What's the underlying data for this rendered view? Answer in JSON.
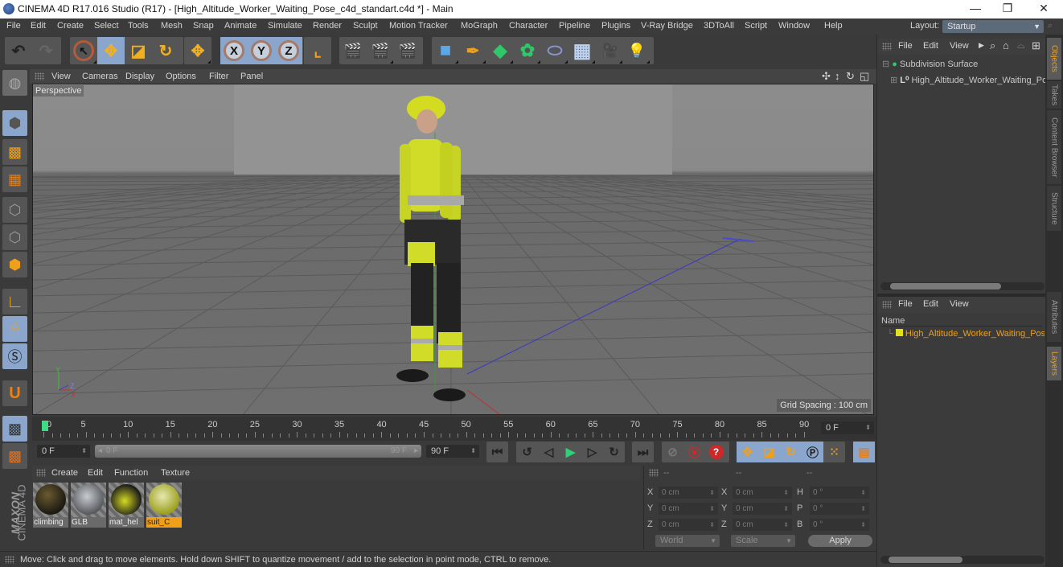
{
  "window": {
    "title": "CINEMA 4D R17.016 Studio (R17) - [High_Altitude_Worker_Waiting_Pose_c4d_standart.c4d *] - Main",
    "controls": {
      "minimize": "—",
      "restore": "❐",
      "close": "✕"
    }
  },
  "menubar": {
    "items": [
      "File",
      "Edit",
      "Create",
      "Select",
      "Tools",
      "Mesh",
      "Snap",
      "Animate",
      "Simulate",
      "Render",
      "Sculpt",
      "Motion Tracker",
      "MoGraph",
      "Character",
      "Pipeline",
      "Plugins",
      "V-Ray Bridge",
      "3DToAll",
      "Script",
      "Window",
      "Help"
    ],
    "layout_label": "Layout:",
    "layout_value": "Startup"
  },
  "toolbar": {
    "groups": [
      {
        "name": "history",
        "tools": [
          {
            "id": "undo",
            "icon": "undo-icon",
            "glyph": "↶"
          },
          {
            "id": "redo",
            "icon": "redo-icon",
            "glyph": "↷"
          }
        ]
      },
      {
        "name": "transform",
        "tools": [
          {
            "id": "live-select",
            "icon": "cursor-icon",
            "glyph": "↖"
          },
          {
            "id": "move",
            "icon": "move-icon",
            "glyph": "✥",
            "active": true
          },
          {
            "id": "scale",
            "icon": "scale-icon",
            "glyph": "◪"
          },
          {
            "id": "rotate",
            "icon": "rotate-icon",
            "glyph": "↻"
          }
        ]
      },
      {
        "name": "recent",
        "tools": [
          {
            "id": "recent-tool",
            "icon": "move-icon",
            "glyph": "✥"
          }
        ]
      },
      {
        "name": "axis",
        "tools": [
          {
            "id": "x-axis",
            "icon": "x-axis-icon",
            "glyph": "X",
            "active": true
          },
          {
            "id": "y-axis",
            "icon": "y-axis-icon",
            "glyph": "Y",
            "active": true
          },
          {
            "id": "z-axis",
            "icon": "z-axis-icon",
            "glyph": "Z",
            "active": true
          }
        ]
      },
      {
        "name": "coords",
        "tools": [
          {
            "id": "coordinate-system",
            "icon": "coordinate-system-icon",
            "glyph": "⌞"
          }
        ]
      },
      {
        "name": "render",
        "tools": [
          {
            "id": "render-view",
            "icon": "render-view-icon",
            "glyph": "🎬"
          },
          {
            "id": "render-picture-viewer",
            "icon": "render-picture-viewer-icon",
            "glyph": "🎬"
          },
          {
            "id": "render-settings",
            "icon": "render-settings-icon",
            "glyph": "🎬"
          }
        ]
      },
      {
        "name": "create",
        "tools": [
          {
            "id": "cube",
            "icon": "cube-icon",
            "glyph": "■"
          },
          {
            "id": "pen",
            "icon": "pen-icon",
            "glyph": "✒"
          },
          {
            "id": "subdivision",
            "icon": "subdivision-surface-icon",
            "glyph": "◆"
          },
          {
            "id": "cloner",
            "icon": "cloner-icon",
            "glyph": "✿"
          },
          {
            "id": "deformer",
            "icon": "deformer-icon",
            "glyph": "⬭"
          },
          {
            "id": "floor",
            "icon": "floor-icon",
            "glyph": "▦"
          },
          {
            "id": "camera",
            "icon": "camera-icon",
            "glyph": "🎥"
          },
          {
            "id": "light",
            "icon": "light-bulb-icon",
            "glyph": "💡"
          }
        ]
      }
    ]
  },
  "left_tools": [
    {
      "id": "make-editable",
      "icon": "make-editable-icon",
      "glyph": "◍"
    },
    {
      "id": "model-mode",
      "icon": "model-mode-icon",
      "glyph": "⬢",
      "active": true
    },
    {
      "id": "texture-mode",
      "icon": "texture-mode-icon",
      "glyph": "▩"
    },
    {
      "id": "workplane-mode",
      "icon": "workplane-icon",
      "glyph": "▦"
    },
    {
      "id": "points-mode",
      "icon": "points-mode-icon",
      "glyph": "⬡"
    },
    {
      "id": "edges-mode",
      "icon": "edges-mode-icon",
      "glyph": "⬡"
    },
    {
      "id": "polygons-mode",
      "icon": "polygons-mode-icon",
      "glyph": "⬢"
    },
    {
      "id": "axis-mode",
      "icon": "axis-mode-icon",
      "glyph": "∟"
    },
    {
      "id": "tweak-mode",
      "icon": "mouse-icon",
      "glyph": "🖱",
      "active": true
    },
    {
      "id": "solo",
      "icon": "solo-icon",
      "glyph": "Ⓢ",
      "active": true
    },
    {
      "id": "snap",
      "icon": "magnet-icon",
      "glyph": "U"
    },
    {
      "id": "workplane-lock",
      "icon": "workplane-lock-icon",
      "glyph": "▩",
      "active": true
    },
    {
      "id": "workplane-locked",
      "icon": "workplane-axis-icon",
      "glyph": "▩"
    }
  ],
  "viewport": {
    "menu": [
      "View",
      "Cameras",
      "Display",
      "Options",
      "Filter",
      "Panel"
    ],
    "camera_label": "Perspective",
    "grid_spacing": "Grid Spacing : 100 cm",
    "nav_icons": [
      "move-view-icon",
      "dolly-icon",
      "rotate-view-icon",
      "toggle-view-icon"
    ]
  },
  "timeline": {
    "ticks": [
      0,
      5,
      10,
      15,
      20,
      25,
      30,
      35,
      40,
      45,
      50,
      55,
      60,
      65,
      70,
      75,
      80,
      85,
      90
    ],
    "current_frame": "0 F",
    "start_field": "0 F",
    "range_start": "0 F",
    "range_end": "90 F",
    "end_field": "90 F",
    "playhead_frame": 0
  },
  "transport": {
    "buttons": [
      {
        "id": "go-to-start",
        "icon": "go-to-start-icon",
        "glyph": "⏮"
      },
      {
        "id": "prev-key",
        "icon": "previous-key-icon",
        "glyph": "↺"
      },
      {
        "id": "prev-frame",
        "icon": "previous-frame-icon",
        "glyph": "◁"
      },
      {
        "id": "play",
        "icon": "play-icon",
        "glyph": "▶"
      },
      {
        "id": "next-frame",
        "icon": "next-frame-icon",
        "glyph": "▷"
      },
      {
        "id": "next-key",
        "icon": "next-key-icon",
        "glyph": "↻"
      },
      {
        "id": "go-to-end",
        "icon": "go-to-end-icon",
        "glyph": "⏭"
      },
      {
        "id": "record",
        "icon": "record-keys-icon",
        "glyph": "⊘"
      },
      {
        "id": "autokey",
        "icon": "autokey-icon",
        "glyph": "⦿"
      },
      {
        "id": "keyframe-selection",
        "icon": "keyframe-selection-icon",
        "glyph": "?"
      },
      {
        "id": "key-position",
        "icon": "position-key-icon",
        "glyph": "✥"
      },
      {
        "id": "key-scale",
        "icon": "scale-key-icon",
        "glyph": "◪"
      },
      {
        "id": "key-rotation",
        "icon": "rotation-key-icon",
        "glyph": "↻"
      },
      {
        "id": "key-param",
        "icon": "parameter-key-icon",
        "glyph": "P"
      },
      {
        "id": "key-pla",
        "icon": "pla-key-icon",
        "glyph": "⁙"
      },
      {
        "id": "timeline-window",
        "icon": "film-strip-icon",
        "glyph": "▤"
      }
    ]
  },
  "materials": {
    "menu": [
      "Create",
      "Edit",
      "Function",
      "Texture"
    ],
    "items": [
      {
        "name": "climbing",
        "color": "#2b2416",
        "selected": false
      },
      {
        "name": "GLB",
        "color": "#9aa0a4",
        "selected": false
      },
      {
        "name": "mat_hel",
        "color": "#bfc21a",
        "selected": false
      },
      {
        "name": "suit_C",
        "color": "#c8cc4a",
        "selected": true
      }
    ]
  },
  "coordinates": {
    "headers": [
      "--",
      "--",
      "--"
    ],
    "rows": [
      {
        "a": "X",
        "a_val": "0 cm",
        "b": "X",
        "b_val": "0 cm",
        "c": "H",
        "c_val": "0 °"
      },
      {
        "a": "Y",
        "a_val": "0 cm",
        "b": "Y",
        "b_val": "0 cm",
        "c": "P",
        "c_val": "0 °"
      },
      {
        "a": "Z",
        "a_val": "0 cm",
        "b": "Z",
        "b_val": "0 cm",
        "c": "B",
        "c_val": "0 °"
      }
    ],
    "space": "World",
    "mode": "Scale",
    "apply": "Apply"
  },
  "status": {
    "text": "Move: Click and drag to move elements. Hold down SHIFT to quantize movement / add to the selection in point mode, CTRL to remove."
  },
  "objects_panel": {
    "menu": [
      "File",
      "Edit",
      "View"
    ],
    "tree": [
      {
        "name": "Subdivision Surface",
        "icon": "subdivision-surface-icon",
        "level": 0
      },
      {
        "name": "High_Altitude_Worker_Waiting_Pose",
        "icon": "null-object-icon",
        "level": 1
      }
    ]
  },
  "layers_panel": {
    "menu": [
      "File",
      "Edit",
      "View"
    ],
    "column": "Name",
    "layers": [
      {
        "name": "High_Altitude_Worker_Waiting_Pose",
        "color": "#e6e01a"
      }
    ]
  },
  "side_tabs": {
    "top": [
      {
        "label": "Objects",
        "active": true
      },
      {
        "label": "Takes"
      },
      {
        "label": "Content Browser"
      },
      {
        "label": "Structure"
      }
    ],
    "bottom": [
      {
        "label": "Attributes"
      },
      {
        "label": "Layers",
        "active": true
      }
    ]
  },
  "branding": {
    "maxon": "MAXON",
    "product": "CINEMA 4D"
  },
  "colors": {
    "accent": "#8aa6cc",
    "highlight": "#f0a018",
    "timeline_playhead": "#3ddc84"
  }
}
